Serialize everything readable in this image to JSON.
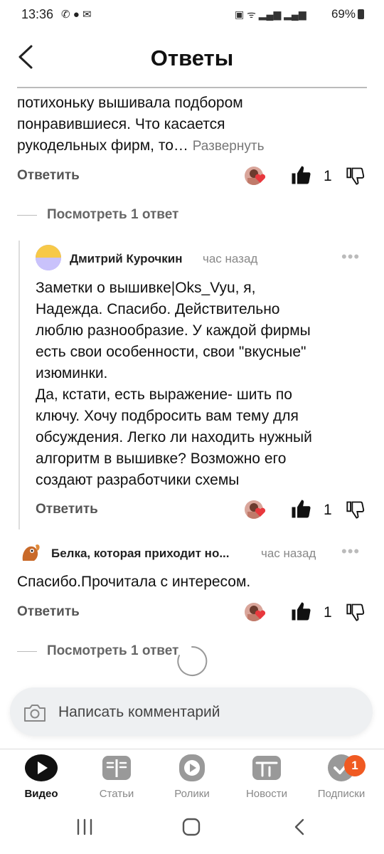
{
  "status": {
    "time": "13:36",
    "battery": "69%"
  },
  "header": {
    "title": "Ответы"
  },
  "comment1": {
    "text_lines": [
      "потихоньку вышивала подбором",
      "понравившиеся. Что касается",
      "рукодельных фирм, то…"
    ],
    "expand_label": "Развернуть",
    "reply_label": "Ответить",
    "likes": "1",
    "view_replies": "Посмотреть 1 ответ"
  },
  "reply1": {
    "author": "Дмитрий Курочкин",
    "time": "час назад",
    "text_lines": [
      "Заметки о вышивке|Oks_Vyu, я,",
      "Надежда. Спасибо. Действительно",
      "люблю разнообразие. У каждой фирмы",
      "есть свои особенности,  свои \"вкусные\"",
      "изюминки.",
      "Да, кстати, есть выражение- шить по",
      "ключу. Хочу подбросить вам тему для",
      "обсуждения. Легко ли находить нужный",
      "алгоритм в вышивке? Возможно его",
      "создают разработчики схемы"
    ],
    "reply_label": "Ответить",
    "likes": "1"
  },
  "comment2": {
    "author": "Белка, которая приходит но...",
    "time": "час назад",
    "text": "Спасибо.Прочитала с интересом.",
    "reply_label": "Ответить",
    "likes": "1",
    "view_replies": "Посмотреть 1 ответ"
  },
  "composer": {
    "placeholder": "Написать комментарий"
  },
  "nav": {
    "items": [
      {
        "label": "Видео",
        "icon": "play-icon",
        "active": true
      },
      {
        "label": "Статьи",
        "icon": "articles-icon"
      },
      {
        "label": "Ролики",
        "icon": "clips-icon"
      },
      {
        "label": "Новости",
        "icon": "news-icon"
      },
      {
        "label": "Подписки",
        "icon": "subscriptions-icon",
        "badge": "1"
      }
    ]
  },
  "colors": {
    "accent": "#f05a22",
    "text": "#111111",
    "muted": "#777777"
  }
}
